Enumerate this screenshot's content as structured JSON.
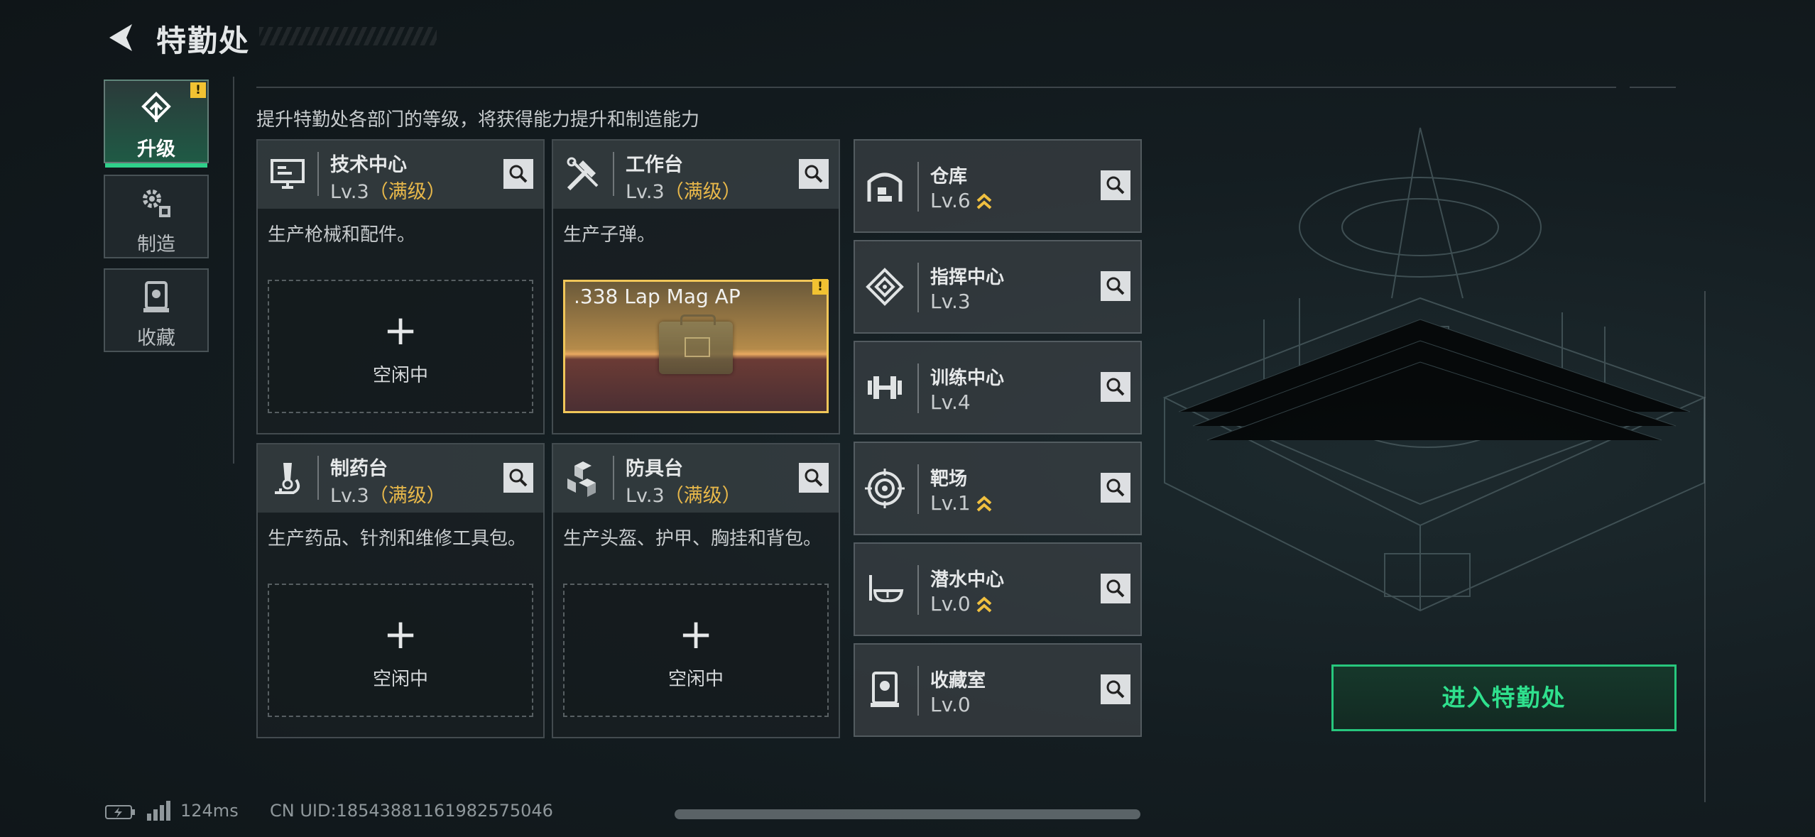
{
  "header": {
    "title": "特勤处"
  },
  "tabs": [
    {
      "label": "升级",
      "icon": "upgrade-icon",
      "active": true,
      "alert": "!"
    },
    {
      "label": "制造",
      "icon": "gears-icon",
      "active": false
    },
    {
      "label": "收藏",
      "icon": "collection-icon",
      "active": false
    }
  ],
  "subtitle": "提升特勤处各部门的等级，将获得能力提升和制造能力",
  "workstations": [
    {
      "name": "技术中心",
      "level": "Lv.3",
      "max": "（满级）",
      "desc": "生产枪械和配件。",
      "icon": "computer-icon",
      "slot_plus": "+",
      "slot_status": "空闲中"
    },
    {
      "name": "工作台",
      "level": "Lv.3",
      "max": "（满级）",
      "desc": "生产子弹。",
      "icon": "tools-icon",
      "item": ".338 Lap Mag AP",
      "alert": "!"
    },
    {
      "name": "制药台",
      "level": "Lv.3",
      "max": "（满级）",
      "desc": "生产药品、针剂和维修工具包。",
      "icon": "microscope-icon",
      "slot_plus": "+",
      "slot_status": "空闲中"
    },
    {
      "name": "防具台",
      "level": "Lv.3",
      "max": "（满级）",
      "desc": "生产头盔、护甲、胸挂和背包。",
      "icon": "armor-cubes-icon",
      "slot_plus": "+",
      "slot_status": "空闲中"
    }
  ],
  "facilities": [
    {
      "name": "仓库",
      "level": "Lv.6",
      "upgradable": true,
      "icon": "warehouse-icon"
    },
    {
      "name": "指挥中心",
      "level": "Lv.3",
      "upgradable": false,
      "icon": "command-icon"
    },
    {
      "name": "训练中心",
      "level": "Lv.4",
      "upgradable": false,
      "icon": "dumbbell-icon"
    },
    {
      "name": "靶场",
      "level": "Lv.1",
      "upgradable": true,
      "icon": "target-icon"
    },
    {
      "name": "潜水中心",
      "level": "Lv.0",
      "upgradable": true,
      "icon": "diving-mask-icon"
    },
    {
      "name": "收藏室",
      "level": "Lv.0",
      "upgradable": false,
      "icon": "display-case-icon"
    }
  ],
  "enter_button": "进入特勤处",
  "status": {
    "ping": "124ms",
    "uid": "CN UID:18543881161982575046"
  },
  "colors": {
    "accent_green": "#2fe08d",
    "max_gold": "#e8b84a",
    "alert_yellow": "#f1c232",
    "upgrade_chevron": "#f0c040"
  }
}
